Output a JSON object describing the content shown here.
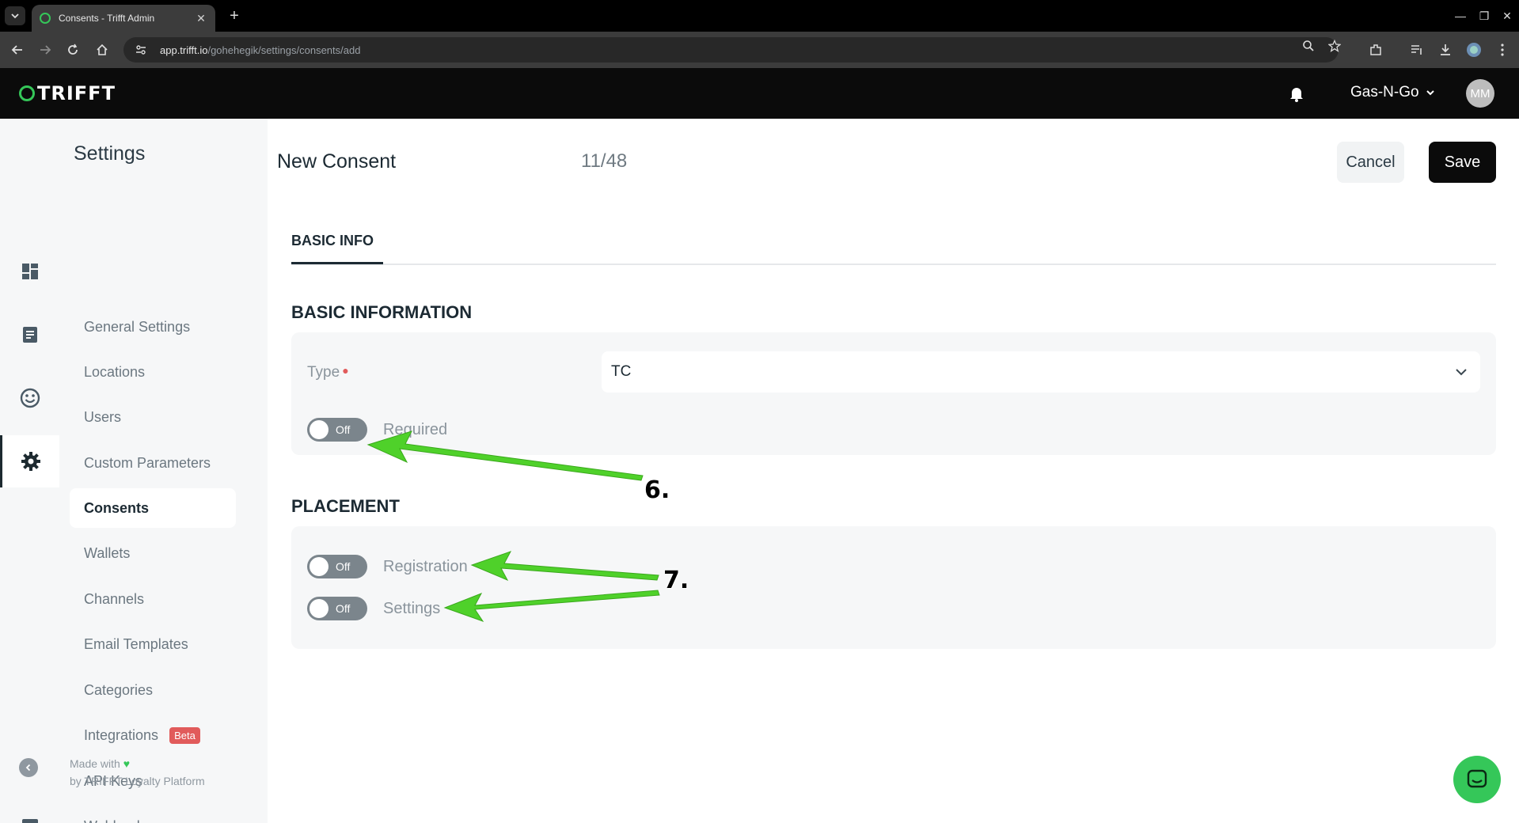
{
  "browser": {
    "tab_title": "Consents - Trifft Admin",
    "new_tab_symbol": "+",
    "url_host": "app.trifft.io",
    "url_path": "/gohehegik/settings/consents/add"
  },
  "header": {
    "logo_text": "TRIFFT",
    "tenant": "Gas-N-Go",
    "avatar_initials": "MM"
  },
  "sidebar": {
    "title": "Settings",
    "items": [
      {
        "label": "General Settings"
      },
      {
        "label": "Locations"
      },
      {
        "label": "Users"
      },
      {
        "label": "Custom Parameters"
      },
      {
        "label": "Consents"
      },
      {
        "label": "Wallets"
      },
      {
        "label": "Channels"
      },
      {
        "label": "Email Templates"
      },
      {
        "label": "Categories"
      },
      {
        "label": "Integrations",
        "badge": "Beta"
      },
      {
        "label": "API Keys"
      },
      {
        "label": "Webhooks"
      }
    ],
    "active_item": "Consents",
    "footer_line1": "Made with",
    "footer_line2": "by TRIFFT Loyalty Platform"
  },
  "page": {
    "title": "New Consent",
    "counter": "11/48",
    "cancel_label": "Cancel",
    "save_label": "Save",
    "tabs": [
      {
        "label": "BASIC INFO"
      }
    ]
  },
  "basic_information": {
    "heading": "BASIC INFORMATION",
    "type_label": "Type",
    "type_value": "TC",
    "required_toggle": {
      "label": "Required",
      "state": "Off"
    }
  },
  "placement": {
    "heading": "PLACEMENT",
    "toggles": [
      {
        "label": "Registration",
        "state": "Off"
      },
      {
        "label": "Settings",
        "state": "Off"
      }
    ]
  },
  "annotations": {
    "step6": "6.",
    "step7": "7."
  },
  "colors": {
    "brand_green": "#35c759",
    "arrow_green": "#4fd12a",
    "beta_red": "#e15b5b",
    "toggle_off": "#7b858c"
  }
}
